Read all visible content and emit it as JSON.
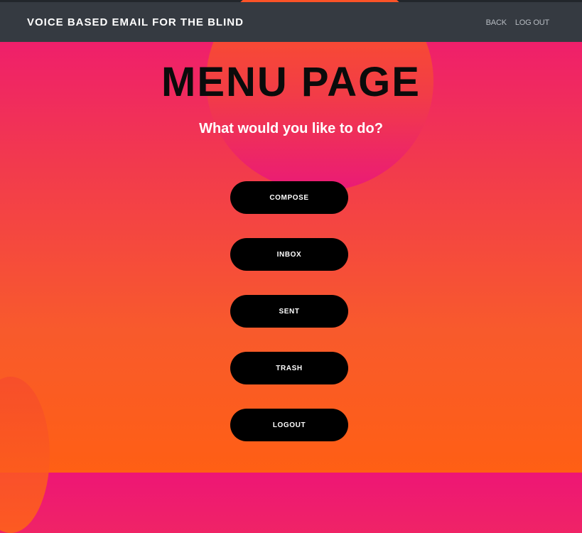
{
  "navbar": {
    "brand": "VOICE BASED EMAIL FOR THE BLIND",
    "links": [
      "BACK",
      "LOG OUT"
    ]
  },
  "main": {
    "title": "MENU PAGE",
    "subtitle": "What would you like to do?",
    "buttons": [
      "COMPOSE",
      "INBOX",
      "SENT",
      "TRASH",
      "LOGOUT"
    ]
  },
  "colors": {
    "navbar_bg": "#353a41",
    "gradient_top": "#ee1675",
    "gradient_bottom": "#ff5f14",
    "button_bg": "#000000",
    "button_text": "#ffffff"
  }
}
